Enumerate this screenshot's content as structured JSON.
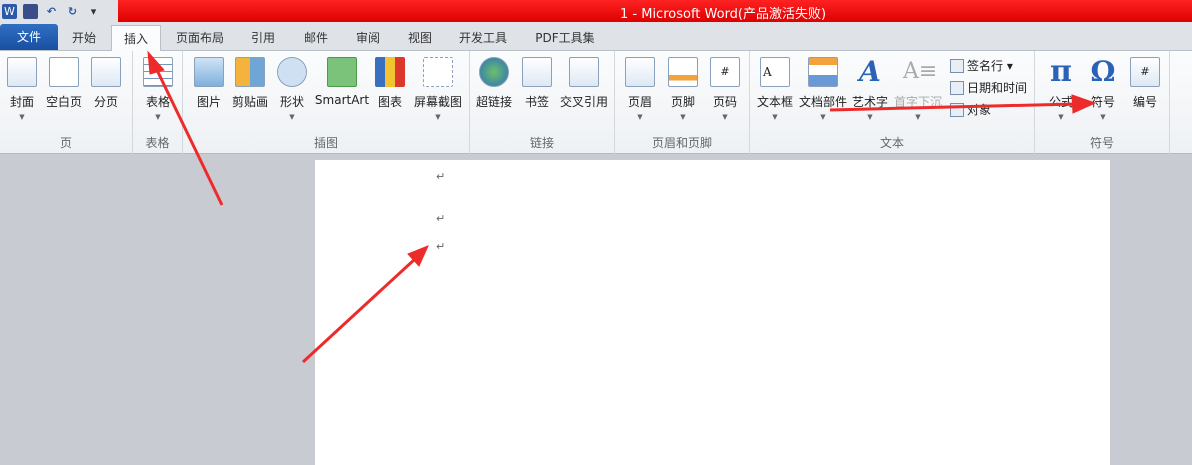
{
  "window": {
    "title": "1  -  Microsoft Word(产品激活失败)",
    "app_icon": "W"
  },
  "qat": {
    "save": "save-icon",
    "undo": "undo-icon",
    "redo": "redo-icon",
    "customize": "▾"
  },
  "tabs": [
    "文件",
    "开始",
    "插入",
    "页面布局",
    "引用",
    "邮件",
    "审阅",
    "视图",
    "开发工具",
    "PDF工具集"
  ],
  "active_tab": "插入",
  "groups": {
    "page": "页",
    "table": "表格",
    "illustrations": "插图",
    "links": "链接",
    "header_footer": "页眉和页脚",
    "text": "文本",
    "symbols": "符号"
  },
  "buttons": {
    "cover": "封面",
    "blank": "空白页",
    "pagebreak": "分页",
    "table": "表格",
    "picture": "图片",
    "clipart": "剪贴画",
    "shapes": "形状",
    "smartart": "SmartArt",
    "chart": "图表",
    "screenshot": "屏幕截图",
    "hyperlink": "超链接",
    "bookmark": "书签",
    "crossref": "交叉引用",
    "header": "页眉",
    "footer": "页脚",
    "pagenum": "页码",
    "textbox": "文本框",
    "quickparts": "文档部件",
    "wordart": "艺术字",
    "dropcap": "首字下沉",
    "equation": "公式",
    "symbol": "符号",
    "number": "编号"
  },
  "small_buttons": {
    "signature": "签名行 ▾",
    "datetime": "日期和时间",
    "object": "对象"
  },
  "document": {
    "paragraph_mark": "↵"
  },
  "colors": {
    "title_red": "#e01010",
    "annotation_arrow": "#ee2b2b",
    "file_tab": "#2a62b5"
  }
}
